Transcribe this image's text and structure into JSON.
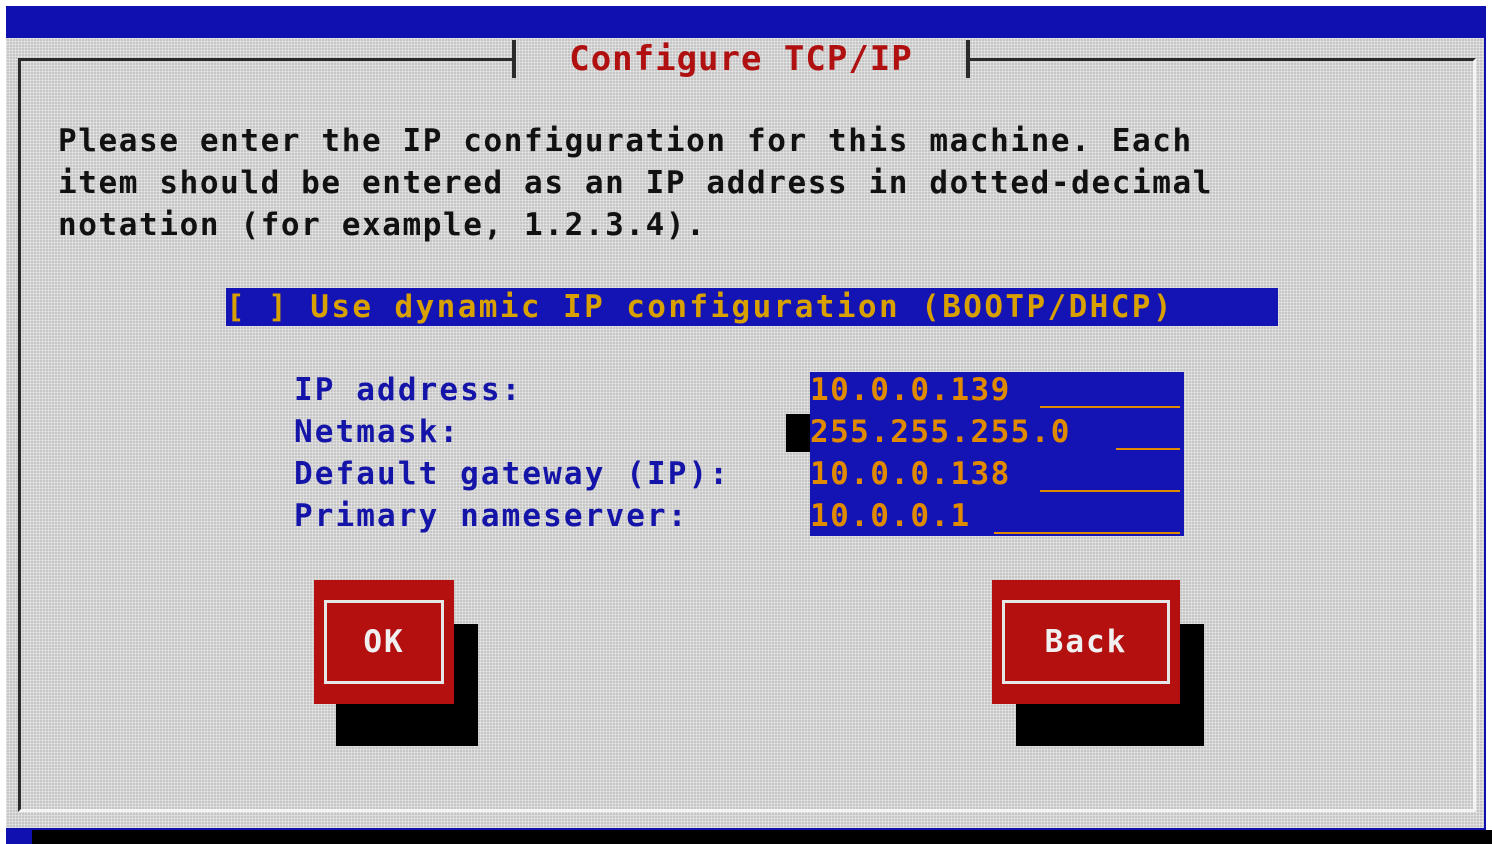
{
  "dialog": {
    "title": "Configure TCP/IP",
    "intro_lines": [
      "Please enter the IP configuration for this machine. Each",
      "item should be entered as an IP address in dotted-decimal",
      "notation (for example, 1.2.3.4)."
    ],
    "dhcp_checkbox": {
      "mark": "[ ]",
      "label": "Use dynamic IP configuration (BOOTP/DHCP)",
      "checked": false
    },
    "fields": [
      {
        "label": "IP address:",
        "value": "10.0.0.139"
      },
      {
        "label": "Netmask:",
        "value": "255.255.255.0"
      },
      {
        "label": "Default gateway (IP):",
        "value": "10.0.0.138"
      },
      {
        "label": "Primary nameserver:",
        "value": "10.0.0.1"
      }
    ],
    "buttons": {
      "ok": "OK",
      "back": "Back"
    }
  },
  "colors": {
    "screen_background": "#1010b0",
    "dialog_background": "#c6c6c6",
    "title_text": "#b01010",
    "field_background": "#1414b4",
    "field_text": "#e08a00",
    "checkbox_text": "#d8a000",
    "label_text": "#1414a8",
    "button_background": "#b41010",
    "button_text": "#f0f0f0"
  }
}
